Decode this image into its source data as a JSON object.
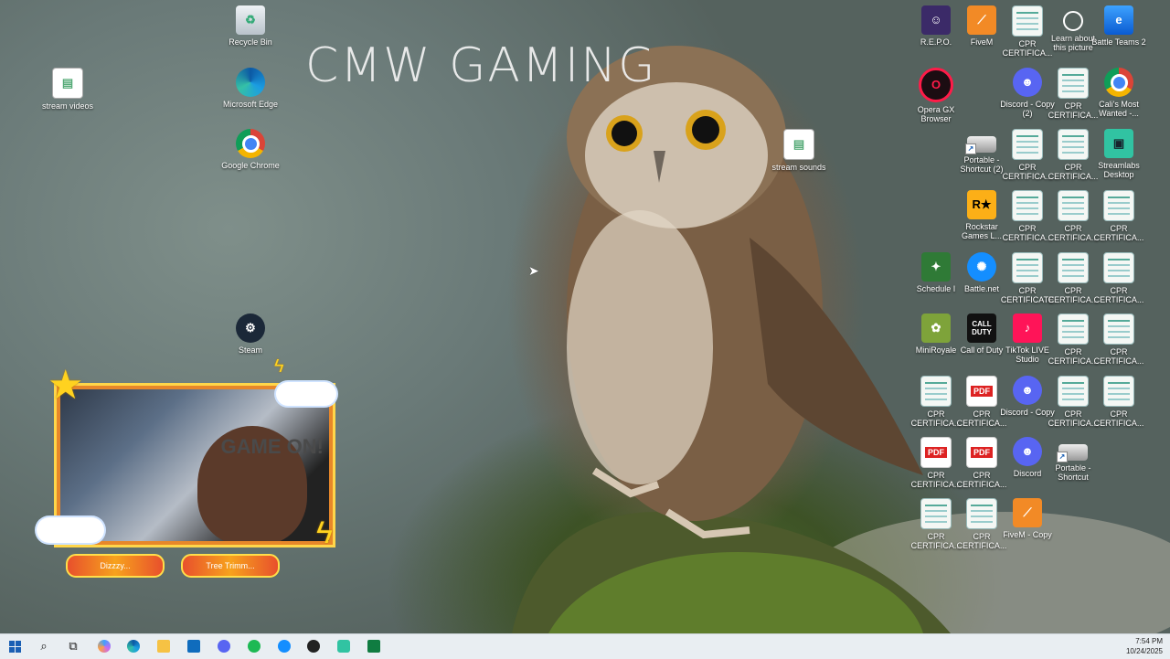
{
  "wallpaper": {
    "brand_text": "CMW GAMING"
  },
  "desktop_left": [
    {
      "label": "Recycle Bin",
      "icon": "recycle-bin-icon"
    },
    {
      "label": "stream videos",
      "icon": "folder-icon"
    },
    {
      "label": "Microsoft Edge",
      "icon": "edge-icon"
    },
    {
      "label": "Google Chrome",
      "icon": "chrome-icon"
    },
    {
      "label": "Steam",
      "icon": "steam-icon"
    },
    {
      "label": "stream sounds",
      "icon": "folder-icon"
    }
  ],
  "desktop_right": {
    "col1": [
      {
        "label": "R.E.P.O.",
        "icon": "repo-icon"
      },
      {
        "label": "Opera GX Browser",
        "icon": "opera-gx-icon"
      },
      {
        "label": "Schedule I",
        "icon": "schedule-i-icon"
      },
      {
        "label": "MiniRoyale",
        "icon": "miniroyale-icon"
      },
      {
        "label": "CPR CERTIFICA...",
        "icon": "certificate-icon"
      },
      {
        "label": "CPR CERTIFICA...",
        "icon": "pdf-icon"
      },
      {
        "label": "CPR CERTIFICA...",
        "icon": "certificate-icon"
      }
    ],
    "col2": [
      {
        "label": "FiveM",
        "icon": "fivem-icon"
      },
      {
        "label": "Portable - Shortcut (2)",
        "icon": "drive-icon"
      },
      {
        "label": "Rockstar Games L...",
        "icon": "rockstar-icon"
      },
      {
        "label": "Battle.net",
        "icon": "battlenet-icon"
      },
      {
        "label": "Call of Duty",
        "icon": "cod-icon"
      },
      {
        "label": "CPR CERTIFICA...",
        "icon": "pdf-icon"
      },
      {
        "label": "CPR CERTIFICA...",
        "icon": "pdf-icon"
      },
      {
        "label": "CPR CERTIFICA...",
        "icon": "certificate-icon"
      }
    ],
    "col3": [
      {
        "label": "CPR CERTIFICA...",
        "icon": "certificate-icon"
      },
      {
        "label": "Discord - Copy (2)",
        "icon": "discord-icon"
      },
      {
        "label": "CPR CERTIFICA...",
        "icon": "certificate-icon"
      },
      {
        "label": "CPR CERTIFICA...",
        "icon": "certificate-icon"
      },
      {
        "label": "CPR CERTIFICATE",
        "icon": "certificate-icon"
      },
      {
        "label": "TikTok LIVE Studio",
        "icon": "tiktok-icon"
      },
      {
        "label": "Discord - Copy",
        "icon": "discord-icon"
      },
      {
        "label": "Discord",
        "icon": "discord-icon"
      },
      {
        "label": "FiveM - Copy",
        "icon": "fivem-icon"
      }
    ],
    "col4": [
      {
        "label": "Learn about this picture",
        "icon": "camera-icon"
      },
      {
        "label": "CPR CERTIFICA...",
        "icon": "certificate-icon"
      },
      {
        "label": "CPR CERTIFICA...",
        "icon": "certificate-icon"
      },
      {
        "label": "CPR CERTIFICA...",
        "icon": "certificate-icon"
      },
      {
        "label": "CPR CERTIFICA...",
        "icon": "certificate-icon"
      },
      {
        "label": "CPR CERTIFICA...",
        "icon": "certificate-icon"
      },
      {
        "label": "CPR CERTIFICA...",
        "icon": "certificate-icon"
      },
      {
        "label": "Portable - Shortcut",
        "icon": "drive-icon"
      }
    ],
    "col5": [
      {
        "label": "Battle Teams 2",
        "icon": "battle-teams-icon"
      },
      {
        "label": "Cali's Most Wanted -...",
        "icon": "chrome-icon"
      },
      {
        "label": "Streamlabs Desktop",
        "icon": "streamlabs-icon"
      },
      {
        "label": "CPR CERTIFICA...",
        "icon": "certificate-icon"
      },
      {
        "label": "CPR CERTIFICA...",
        "icon": "certificate-icon"
      },
      {
        "label": "CPR CERTIFICA...",
        "icon": "certificate-icon"
      },
      {
        "label": "CPR CERTIFICA...",
        "icon": "certificate-icon"
      }
    ]
  },
  "overlay": {
    "shirt_text": "GAME ON!",
    "alert_left": "Dizzzy...",
    "alert_right": "Tree Trimm..."
  },
  "taskbar": {
    "items": [
      "start-icon",
      "search-icon",
      "task-view-icon",
      "copilot-icon",
      "edge-icon",
      "file-explorer-icon",
      "outlook-icon",
      "discord-icon",
      "spotify-icon",
      "battlenet-icon",
      "media-player-icon",
      "streamlabs-icon",
      "excel-icon"
    ],
    "time": "7:54 PM",
    "date": "10/24/2025"
  }
}
